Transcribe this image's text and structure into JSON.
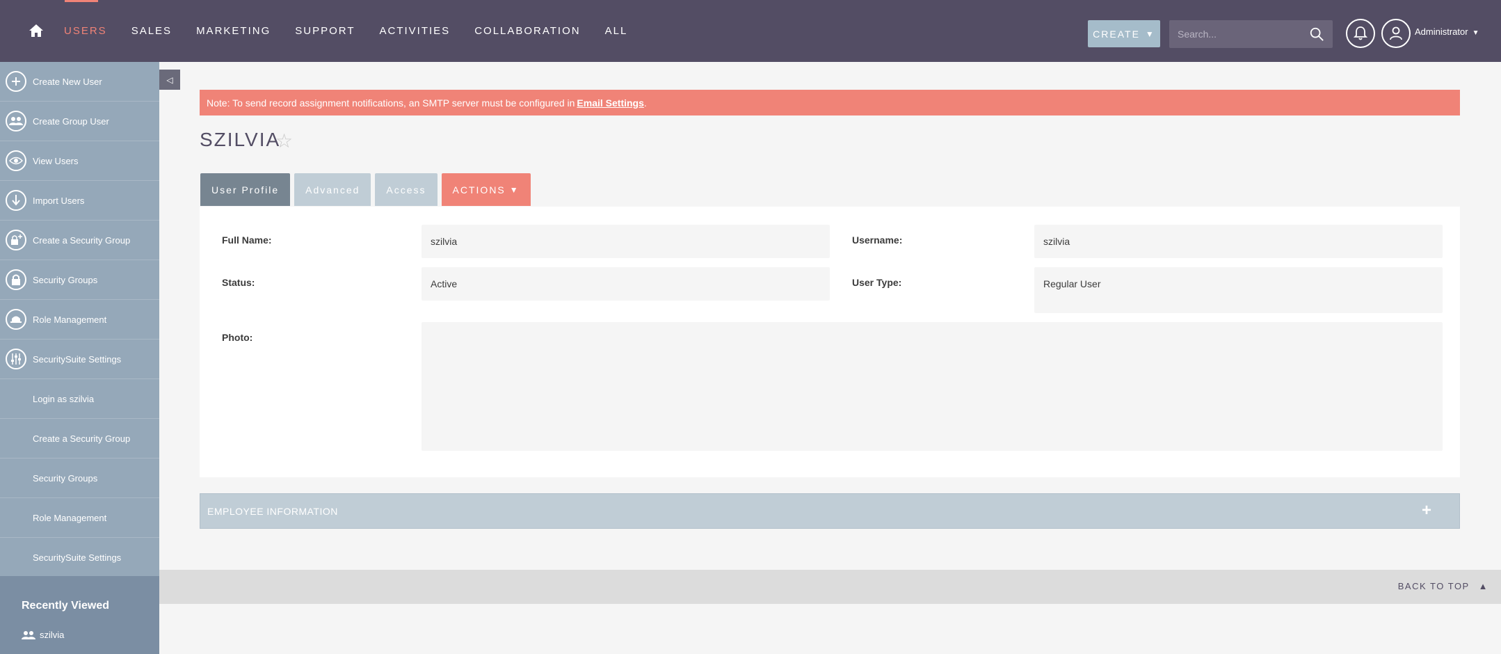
{
  "nav": {
    "items": [
      "USERS",
      "SALES",
      "MARKETING",
      "SUPPORT",
      "ACTIVITIES",
      "COLLABORATION",
      "ALL"
    ],
    "active_index": 0,
    "create_label": "CREATE",
    "search_placeholder": "Search...",
    "user_label": "Administrator"
  },
  "sidebar": {
    "items": [
      {
        "label": "Create New User",
        "icon": "plus-icon"
      },
      {
        "label": "Create Group User",
        "icon": "group-icon"
      },
      {
        "label": "View Users",
        "icon": "eye-icon"
      },
      {
        "label": "Import Users",
        "icon": "download-icon"
      },
      {
        "label": "Create a Security Group",
        "icon": "lock-plus-icon"
      },
      {
        "label": "Security Groups",
        "icon": "lock-icon"
      },
      {
        "label": "Role Management",
        "icon": "hat-icon"
      },
      {
        "label": "SecuritySuite Settings",
        "icon": "sliders-icon"
      },
      {
        "label": "Login as szilvia",
        "icon": ""
      },
      {
        "label": "Create a Security Group",
        "icon": ""
      },
      {
        "label": "Security Groups",
        "icon": ""
      },
      {
        "label": "Role Management",
        "icon": ""
      },
      {
        "label": "SecuritySuite Settings",
        "icon": ""
      }
    ],
    "recent_title": "Recently Viewed",
    "recent_items": [
      "szilvia"
    ]
  },
  "alert": {
    "text": "Note: To send record assignment notifications, an SMTP server must be configured in",
    "link": "Email Settings",
    "suffix": "."
  },
  "record": {
    "title": "SZILVIA",
    "tabs": [
      "User Profile",
      "Advanced",
      "Access",
      "ACTIONS"
    ],
    "fields": {
      "full_name_label": "Full Name:",
      "full_name_value": "szilvia",
      "username_label": "Username:",
      "username_value": "szilvia",
      "status_label": "Status:",
      "status_value": "Active",
      "user_type_label": "User Type:",
      "user_type_value": "Regular User",
      "photo_label": "Photo:"
    }
  },
  "employee_info_label": "EMPLOYEE INFORMATION",
  "footer": {
    "back_to_top": "BACK TO TOP"
  },
  "colors": {
    "accent": "#f08377",
    "topbar": "#534d64",
    "sidebar": "#95a8b9"
  }
}
